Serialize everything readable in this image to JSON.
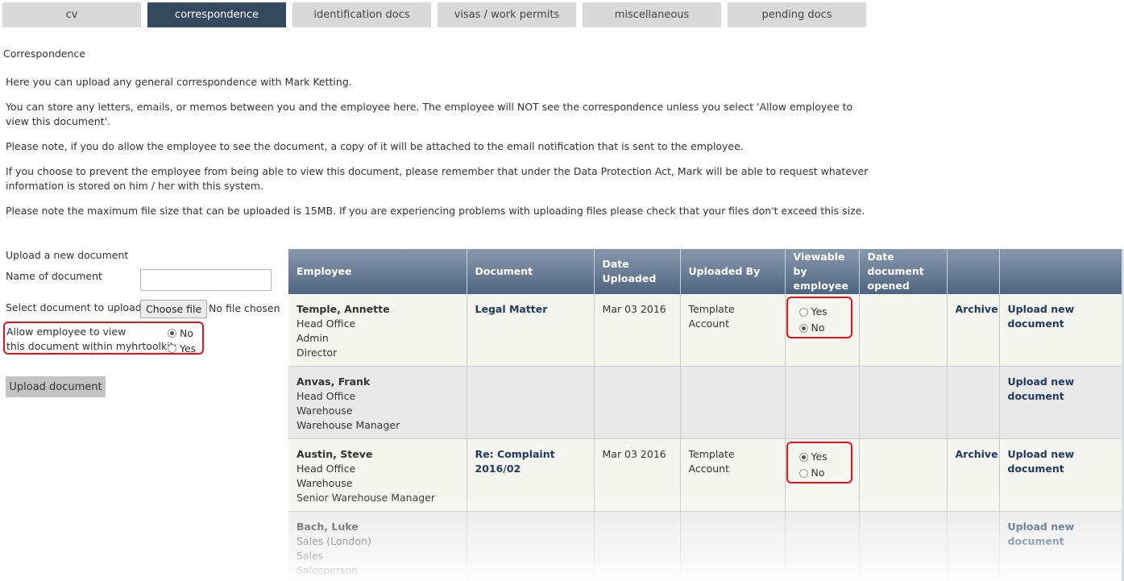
{
  "tabs": [
    "cv",
    "correspondence",
    "identification docs",
    "visas / work permits",
    "miscellaneous",
    "pending docs"
  ],
  "heading": "Correspondence",
  "intro": [
    "Here you can upload any general correspondence with Mark Ketting.",
    "You can store any letters, emails, or memos between you and the employee here. The employee will NOT see the correspondence unless you select 'Allow employee to view this document'.",
    "Please note, if you do allow the employee to see the document, a copy of it will be attached to the email notification that is sent to the employee.",
    "If you choose to prevent the employee from being able to view this document, please remember that under the Data Protection Act, Mark will be able to request whatever information is stored on him / her with this system.",
    "Please note the maximum file size that can be uploaded is 15MB. If you are experiencing problems with uploading files please check that your files don't exceed this size."
  ],
  "upload": {
    "title": "Upload a new document",
    "name_label": "Name of document",
    "name_value": "",
    "select_label": "Select document to upload:",
    "choose_file": "Choose file",
    "file_status": "No file chosen",
    "allow_line1": "Allow employee to view",
    "allow_line2": "this document within myhrtoolkit:",
    "opt_no": "No",
    "opt_yes": "Yes",
    "selected": "No",
    "button": "Upload document"
  },
  "table": {
    "headers": [
      "Employee",
      "Document",
      "Date Uploaded",
      "Uploaded By",
      "Viewable by employee",
      "Date document opened",
      "",
      ""
    ],
    "rows": [
      {
        "name": "Temple, Annette",
        "location": "Head Office",
        "dept": "Admin",
        "role": "Director",
        "document": "Legal Matter",
        "date": "Mar 03 2016",
        "by": "Template Account",
        "viewable": "No",
        "opened": "",
        "archive": "Archive",
        "upload": "Upload new document"
      },
      {
        "name": "Anvas, Frank",
        "location": "Head Office",
        "dept": "Warehouse",
        "role": "Warehouse Manager",
        "document": "",
        "date": "",
        "by": "",
        "viewable": "",
        "opened": "",
        "archive": "",
        "upload": "Upload new document"
      },
      {
        "name": "Austin, Steve",
        "location": "Head Office",
        "dept": "Warehouse",
        "role": "Senior Warehouse Manager",
        "document": "Re: Complaint 2016/02",
        "date": "Mar 03 2016",
        "by": "Template Account",
        "viewable": "Yes",
        "opened": "",
        "archive": "Archive",
        "upload": "Upload new document"
      },
      {
        "name": "Bach, Luke",
        "location": "Sales (London)",
        "dept": "Sales",
        "role": "Salesperson",
        "document": "",
        "date": "",
        "by": "",
        "viewable": "",
        "opened": "",
        "archive": "",
        "upload": "Upload new document"
      }
    ],
    "yes_label": "Yes",
    "no_label": "No"
  },
  "colors": {
    "active_tab": "#34495e",
    "header": "#4e6480",
    "highlight": "#e0141e",
    "link": "#1f3a63"
  }
}
